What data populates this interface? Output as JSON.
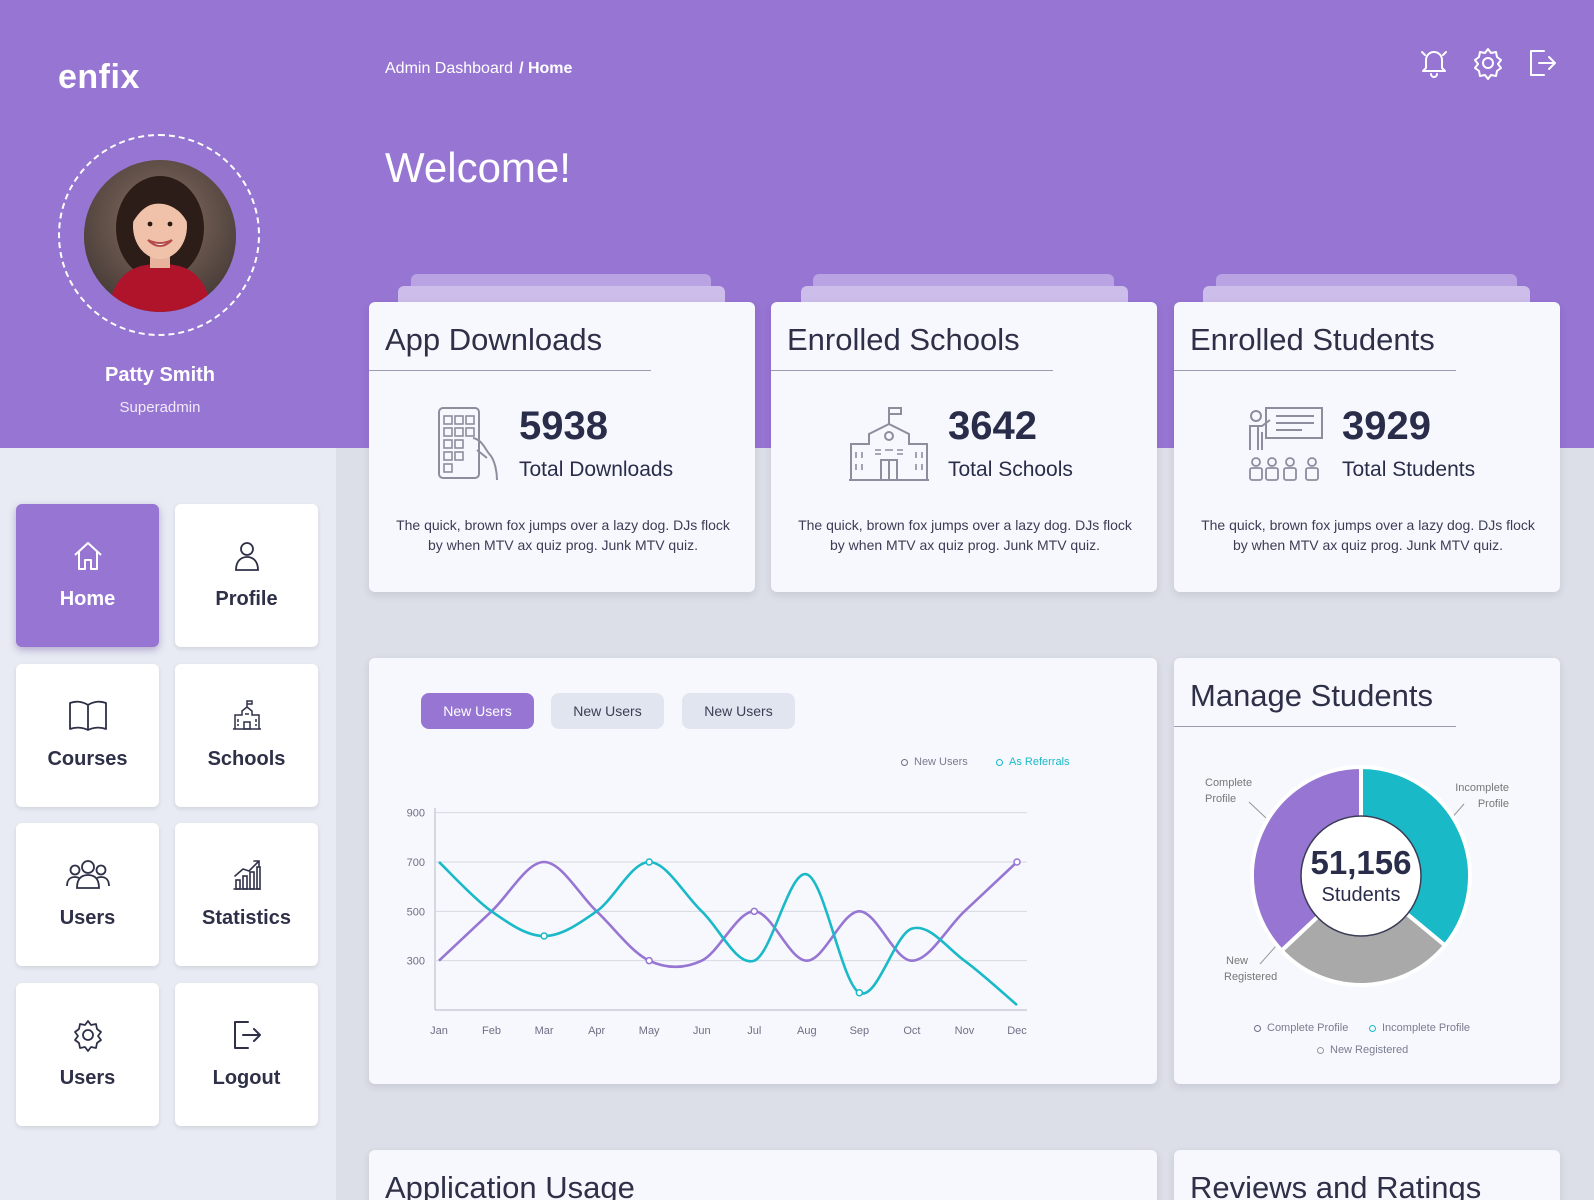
{
  "brand": {
    "name": "enfix"
  },
  "user": {
    "name": "Patty Smith",
    "role": "Superadmin"
  },
  "breadcrumb": {
    "root": "Admin Dashboard",
    "current": "/ Home"
  },
  "header": {
    "welcome": "Welcome!",
    "icons": [
      "bell-icon",
      "gear-icon",
      "logout-icon"
    ]
  },
  "nav": {
    "items": [
      {
        "label": "Home",
        "icon": "home-icon",
        "active": true
      },
      {
        "label": "Profile",
        "icon": "user-icon"
      },
      {
        "label": "Courses",
        "icon": "book-icon"
      },
      {
        "label": "Schools",
        "icon": "school-icon"
      },
      {
        "label": "Users",
        "icon": "users-icon"
      },
      {
        "label": "Statistics",
        "icon": "statistics-icon"
      },
      {
        "label": "Users",
        "icon": "gear-icon"
      },
      {
        "label": "Logout",
        "icon": "logout-icon"
      }
    ]
  },
  "stats": [
    {
      "title": "App Downloads",
      "value": "5938",
      "label": "Total Downloads",
      "icon": "phone-icon",
      "desc": "The quick, brown fox jumps over a lazy dog. DJs flock by when MTV ax quiz prog. Junk MTV quiz."
    },
    {
      "title": "Enrolled Schools",
      "value": "3642",
      "label": "Total Schools",
      "icon": "school-icon",
      "desc": "The quick, brown fox jumps over a lazy dog. DJs flock by when MTV ax quiz prog. Junk MTV quiz."
    },
    {
      "title": "Enrolled Students",
      "value": "3929",
      "label": "Total Students",
      "icon": "classroom-icon",
      "desc": "The quick, brown fox jumps over a lazy dog. DJs flock by when MTV ax quiz prog. Junk MTV quiz."
    }
  ],
  "users_chart": {
    "tabs": [
      "New Users",
      "New Users",
      "New Users"
    ],
    "active_tab": 0,
    "legend": [
      "New Users",
      "As Referrals"
    ]
  },
  "manage_students": {
    "title": "Manage Students",
    "total": "51,156",
    "total_label": "Students",
    "labels": {
      "complete_line1": "Complete",
      "complete_line2": "Profile",
      "incomplete_line1": "Incomplete",
      "incomplete_line2": "Profile",
      "new_line1": "New",
      "new_line2": "Registered"
    },
    "legend": [
      "Complete Profile",
      "Incomplete Profile",
      "New Registered"
    ]
  },
  "bottom_cards": {
    "usage_title": "Application Usage",
    "reviews_title": "Reviews and Ratings"
  },
  "colors": {
    "primary": "#9775d3",
    "teal": "#1ab9c8",
    "gray": "#a9a9a9"
  },
  "chart_data": [
    {
      "type": "line",
      "x": [
        "Jan",
        "Feb",
        "Mar",
        "Apr",
        "May",
        "Jun",
        "Jul",
        "Aug",
        "Sep",
        "Oct",
        "Nov",
        "Dec"
      ],
      "yticks": [
        300,
        500,
        700,
        900
      ],
      "ylim": [
        100,
        1000
      ],
      "grid": true,
      "legend_position": "top-right",
      "series": [
        {
          "name": "New Users",
          "color": "#9775d3",
          "values": [
            300,
            500,
            700,
            500,
            300,
            300,
            500,
            300,
            500,
            300,
            500,
            700
          ]
        },
        {
          "name": "As Referrals",
          "color": "#1ab9c8",
          "values": [
            700,
            500,
            400,
            500,
            700,
            500,
            300,
            650,
            170,
            430,
            300,
            120
          ]
        }
      ]
    },
    {
      "type": "pie",
      "donut": true,
      "labels": [
        "Complete Profile",
        "Incomplete Profile",
        "New Registered"
      ],
      "values": [
        37,
        36,
        27
      ],
      "colors": [
        "#9775d3",
        "#1ab9c8",
        "#a9a9a9"
      ]
    }
  ]
}
